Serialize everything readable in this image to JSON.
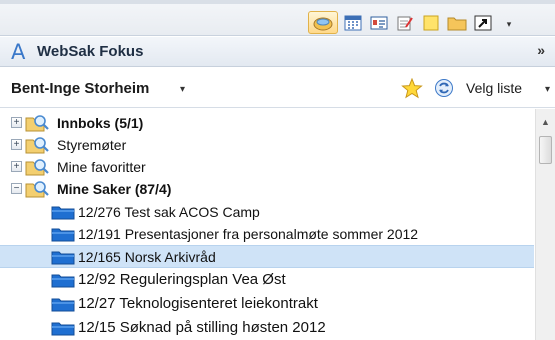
{
  "header": {
    "logo": "A",
    "title": "WebSak Fokus",
    "collapse": "»"
  },
  "user": {
    "name": "Bent-Inge Storheim",
    "caret": "▾"
  },
  "list_select": {
    "label": "Velg liste",
    "caret": "▾"
  },
  "tree": {
    "nodes": [
      {
        "label": "Innboks (5/1)",
        "expander": "+"
      },
      {
        "label": "Styremøter",
        "expander": "+"
      },
      {
        "label": "Mine favoritter",
        "expander": "+"
      },
      {
        "label": "Mine Saker (87/4)",
        "expander": "−"
      }
    ],
    "cases": [
      {
        "label": "12/276 Test sak ACOS Camp"
      },
      {
        "label": "12/191 Presentasjoner fra personalmøte sommer 2012"
      },
      {
        "label": "12/165 Norsk Arkivråd",
        "selected": true
      },
      {
        "label": "12/92  Reguleringsplan Vea Øst"
      },
      {
        "label": "12/27  Teknologisenteret leiekontrakt"
      },
      {
        "label": "12/15  Søknad på stilling høsten 2012"
      }
    ]
  },
  "scrollbar": {
    "up_arrow": "▲"
  },
  "colors": {
    "accent": "#3a78c9",
    "selected_row": "#cfe3f7",
    "folder_blue": "#1f6fd1"
  }
}
